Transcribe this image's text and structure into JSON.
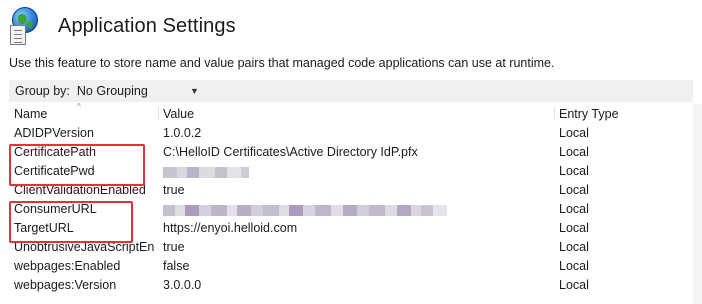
{
  "header": {
    "title": "Application Settings",
    "icon": "globe-document-icon"
  },
  "description": "Use this feature to store name and value pairs that managed code applications can use at runtime.",
  "toolbar": {
    "group_by_label": "Group by:",
    "group_by_value": "No Grouping"
  },
  "table": {
    "columns": {
      "name": "Name",
      "value": "Value",
      "entry_type": "Entry Type"
    },
    "rows": [
      {
        "name": "ADIDPVersion",
        "value": "1.0.0.2",
        "entry_type": "Local"
      },
      {
        "name": "CertificatePath",
        "value": "C:\\HelloID Certificates\\Active Directory IdP.pfx",
        "entry_type": "Local"
      },
      {
        "name": "CertificatePwd",
        "value": "",
        "entry_type": "Local"
      },
      {
        "name": "ClientValidationEnabled",
        "value": "true",
        "entry_type": "Local"
      },
      {
        "name": "ConsumerURL",
        "value": "",
        "entry_type": "Local"
      },
      {
        "name": "TargetURL",
        "value": "https://enyoi.helloid.com",
        "entry_type": "Local"
      },
      {
        "name": "UnobtrusiveJavaScriptEn...",
        "value": "true",
        "entry_type": "Local"
      },
      {
        "name": "webpages:Enabled",
        "value": "false",
        "entry_type": "Local"
      },
      {
        "name": "webpages:Version",
        "value": "3.0.0.0",
        "entry_type": "Local"
      }
    ]
  },
  "colors": {
    "highlight": "#e0343a",
    "toolbar_bg": "#f0f0f0"
  }
}
